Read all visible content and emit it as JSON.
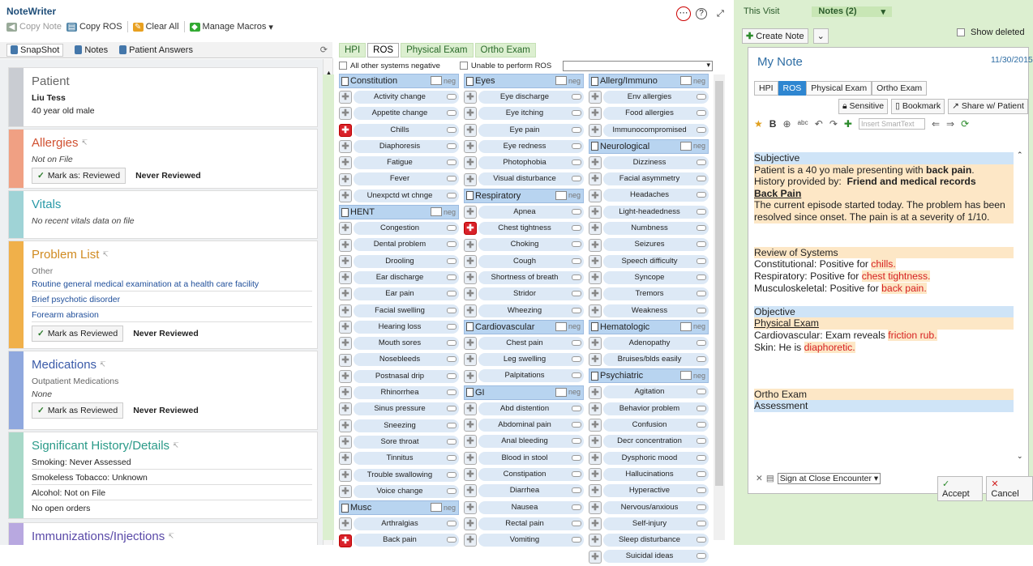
{
  "app": {
    "title": "NoteWriter"
  },
  "toolbar": {
    "copy_note": "Copy Note",
    "copy_ros": "Copy ROS",
    "clear_all": "Clear All",
    "manage_macros": "Manage Macros"
  },
  "left_tabs": [
    "SnapShot",
    "Notes",
    "Patient Answers"
  ],
  "patient": {
    "heading": "Patient",
    "name": "Liu Tess",
    "desc": "40 year old male"
  },
  "allergies": {
    "heading": "Allergies",
    "status": "Not on File",
    "mark": "Mark as: Reviewed",
    "never": "Never Reviewed"
  },
  "vitals": {
    "heading": "Vitals",
    "status": "No recent vitals data on file"
  },
  "problems": {
    "heading": "Problem List",
    "sub": "Other",
    "items": [
      "Routine general medical examination at a health care facility",
      "Brief psychotic disorder",
      "Forearm abrasion"
    ],
    "mark": "Mark as Reviewed",
    "never": "Never Reviewed"
  },
  "medications": {
    "heading": "Medications",
    "sub": "Outpatient Medications",
    "status": "None",
    "mark": "Mark as Reviewed",
    "never": "Never Reviewed"
  },
  "history": {
    "heading": "Significant History/Details",
    "items": [
      "Smoking: Never Assessed",
      "Smokeless Tobacco: Unknown",
      "Alcohol: Not on File",
      "No open orders"
    ]
  },
  "immun": {
    "heading": "Immunizations/Injections"
  },
  "ros_tabs": [
    "HPI",
    "ROS",
    "Physical Exam",
    "Ortho Exam"
  ],
  "ros_ctl": {
    "all_neg": "All other systems negative",
    "unable": "Unable to perform ROS"
  },
  "neg": "neg",
  "col1": [
    {
      "g": "Constitution",
      "items": [
        [
          "Activity change",
          0
        ],
        [
          "Appetite change",
          0
        ],
        [
          "Chills",
          1
        ],
        [
          "Diaphoresis",
          0
        ],
        [
          "Fatigue",
          0
        ],
        [
          "Fever",
          0
        ],
        [
          "Unexpctd wt chnge",
          0
        ]
      ]
    },
    {
      "g": "HENT",
      "items": [
        [
          "Congestion",
          0
        ],
        [
          "Dental problem",
          0
        ],
        [
          "Drooling",
          0
        ],
        [
          "Ear discharge",
          0
        ],
        [
          "Ear pain",
          0
        ],
        [
          "Facial swelling",
          0
        ],
        [
          "Hearing loss",
          0
        ],
        [
          "Mouth sores",
          0
        ],
        [
          "Nosebleeds",
          0
        ],
        [
          "Postnasal drip",
          0
        ],
        [
          "Rhinorrhea",
          0
        ],
        [
          "Sinus pressure",
          0
        ],
        [
          "Sneezing",
          0
        ],
        [
          "Sore throat",
          0
        ],
        [
          "Tinnitus",
          0
        ],
        [
          "Trouble swallowing",
          0
        ],
        [
          "Voice change",
          0
        ]
      ]
    },
    {
      "g": "Musc",
      "items": [
        [
          "Arthralgias",
          0
        ],
        [
          "Back pain",
          1
        ]
      ]
    }
  ],
  "col2": [
    {
      "g": "Eyes",
      "items": [
        [
          "Eye discharge",
          0
        ],
        [
          "Eye itching",
          0
        ],
        [
          "Eye pain",
          0
        ],
        [
          "Eye redness",
          0
        ],
        [
          "Photophobia",
          0
        ],
        [
          "Visual disturbance",
          0
        ]
      ]
    },
    {
      "g": "Respiratory",
      "items": [
        [
          "Apnea",
          0
        ],
        [
          "Chest tightness",
          1
        ],
        [
          "Choking",
          0
        ],
        [
          "Cough",
          0
        ],
        [
          "Shortness of breath",
          0
        ],
        [
          "Stridor",
          0
        ],
        [
          "Wheezing",
          0
        ]
      ]
    },
    {
      "g": "Cardiovascular",
      "items": [
        [
          "Chest pain",
          0
        ],
        [
          "Leg swelling",
          0
        ],
        [
          "Palpitations",
          0
        ]
      ]
    },
    {
      "g": "GI",
      "items": [
        [
          "Abd distention",
          0
        ],
        [
          "Abdominal pain",
          0
        ],
        [
          "Anal bleeding",
          0
        ],
        [
          "Blood in stool",
          0
        ],
        [
          "Constipation",
          0
        ],
        [
          "Diarrhea",
          0
        ],
        [
          "Nausea",
          0
        ],
        [
          "Rectal pain",
          0
        ],
        [
          "Vomiting",
          0
        ]
      ]
    }
  ],
  "col3": [
    {
      "g": "Allerg/Immuno",
      "items": [
        [
          "Env allergies",
          0
        ],
        [
          "Food allergies",
          0
        ],
        [
          "Immunocompromised",
          0
        ]
      ]
    },
    {
      "g": "Neurological",
      "items": [
        [
          "Dizziness",
          0
        ],
        [
          "Facial asymmetry",
          0
        ],
        [
          "Headaches",
          0
        ],
        [
          "Light-headedness",
          0
        ],
        [
          "Numbness",
          0
        ],
        [
          "Seizures",
          0
        ],
        [
          "Speech difficulty",
          0
        ],
        [
          "Syncope",
          0
        ],
        [
          "Tremors",
          0
        ],
        [
          "Weakness",
          0
        ]
      ]
    },
    {
      "g": "Hematologic",
      "items": [
        [
          "Adenopathy",
          0
        ],
        [
          "Bruises/blds easily",
          0
        ]
      ]
    },
    {
      "g": "Psychiatric",
      "items": [
        [
          "Agitation",
          0
        ],
        [
          "Behavior problem",
          0
        ],
        [
          "Confusion",
          0
        ],
        [
          "Decr concentration",
          0
        ],
        [
          "Dysphoric mood",
          0
        ],
        [
          "Hallucinations",
          0
        ],
        [
          "Hyperactive",
          0
        ],
        [
          "Nervous/anxious",
          0
        ],
        [
          "Self-injury",
          0
        ],
        [
          "Sleep disturbance",
          0
        ],
        [
          "Suicidal ideas",
          0
        ]
      ]
    }
  ],
  "right": {
    "this_visit": "This Visit",
    "notes": "Notes (2)",
    "create": "Create Note",
    "show_deleted": "Show deleted"
  },
  "note": {
    "title": "My Note",
    "date": "11/30/2015",
    "tabs": [
      "HPI",
      "ROS",
      "Physical Exam",
      "Ortho Exam"
    ],
    "sensitive": "Sensitive",
    "bookmark": "Bookmark",
    "share": "Share w/ Patient",
    "smarttext": "Insert SmartText"
  },
  "foot": {
    "sign": "Sign at Close Encounter",
    "accept": "Accept",
    "cancel": "Cancel"
  }
}
